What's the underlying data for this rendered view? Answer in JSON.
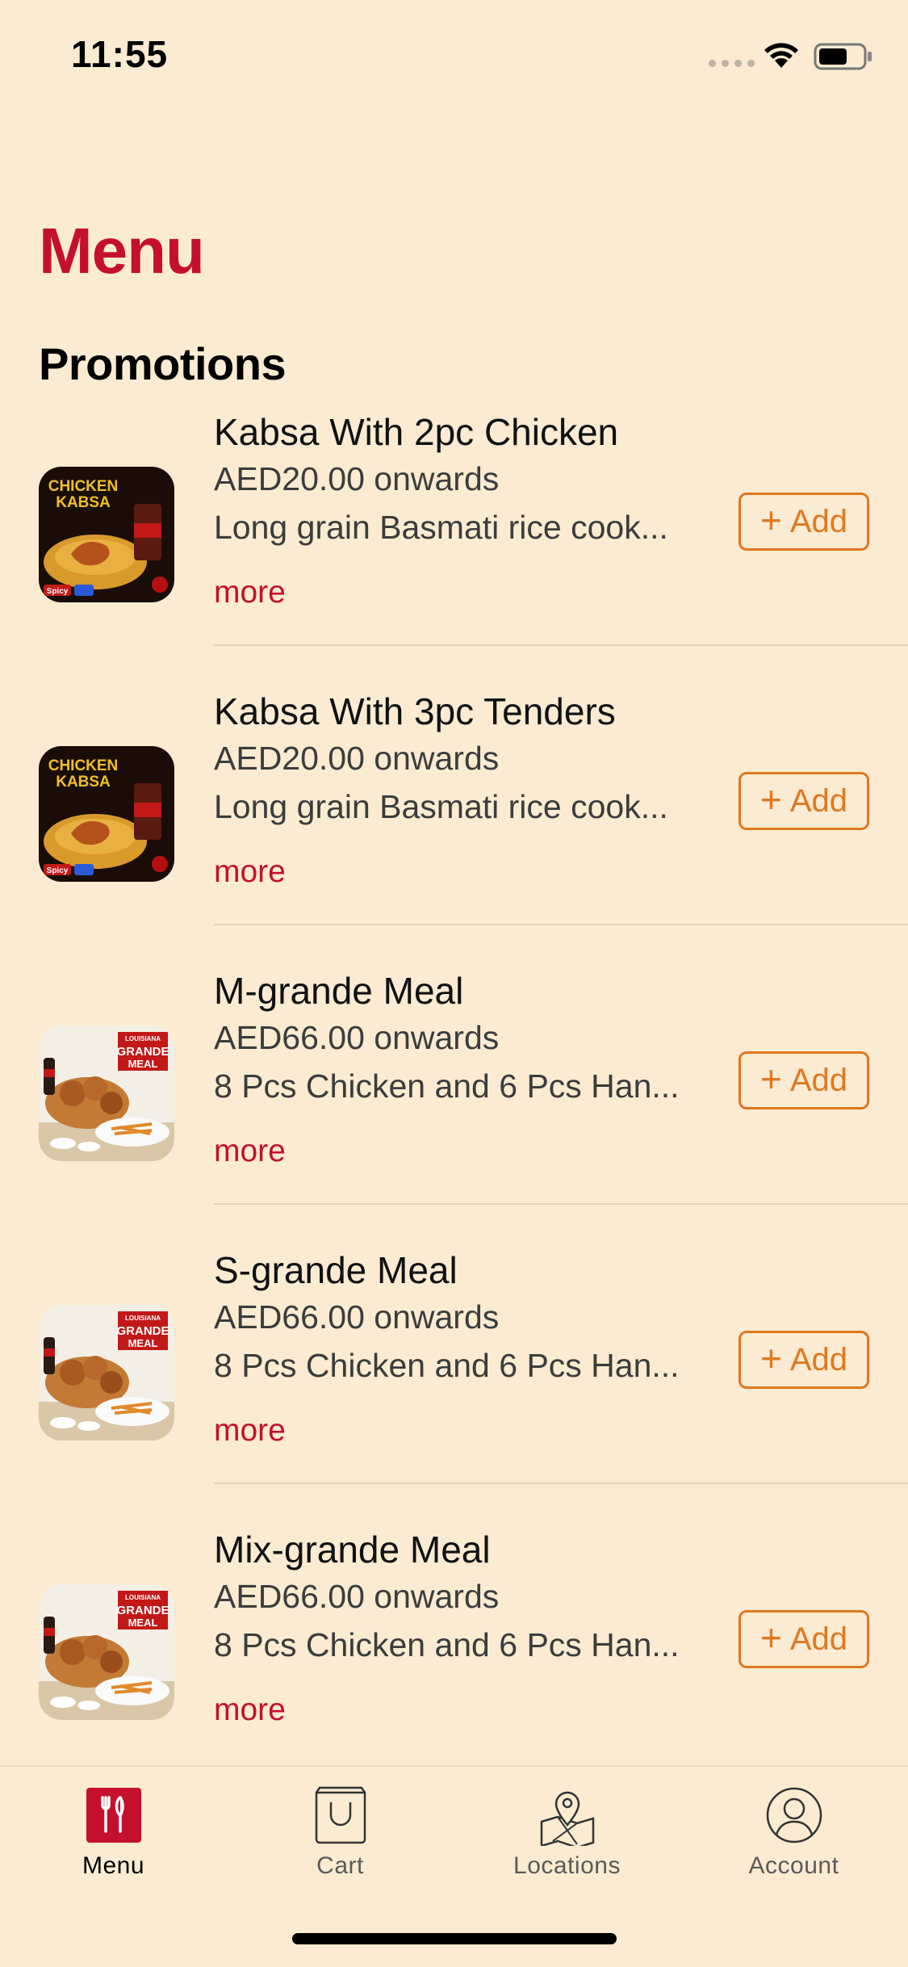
{
  "status_bar": {
    "time": "11:55"
  },
  "page_title": "Menu",
  "section_title": "Promotions",
  "items": [
    {
      "name": "Kabsa With 2pc Chicken",
      "price": "AED20.00 onwards",
      "description": "Long grain Basmati rice cook...",
      "more": "more",
      "add": "Add",
      "thumb": "kabsa"
    },
    {
      "name": "Kabsa With 3pc Tenders",
      "price": "AED20.00 onwards",
      "description": "Long grain Basmati rice cook...",
      "more": "more",
      "add": "Add",
      "thumb": "kabsa"
    },
    {
      "name": "M-grande Meal",
      "price": "AED66.00 onwards",
      "description": "8 Pcs Chicken and 6 Pcs Han...",
      "more": "more",
      "add": "Add",
      "thumb": "grande"
    },
    {
      "name": "S-grande Meal",
      "price": "AED66.00 onwards",
      "description": "8 Pcs Chicken and 6 Pcs Han...",
      "more": "more",
      "add": "Add",
      "thumb": "grande"
    },
    {
      "name": "Mix-grande Meal",
      "price": "AED66.00 onwards",
      "description": "8 Pcs Chicken and 6 Pcs Han...",
      "more": "more",
      "add": "Add",
      "thumb": "grande"
    }
  ],
  "thumb_text": {
    "kabsa": {
      "line1": "CHICKEN",
      "line2": "KABSA",
      "badge": "Spicy"
    },
    "grande": {
      "line0": "LOUISIANA",
      "line1": "GRANDE",
      "line2": "MEAL"
    }
  },
  "tabs": [
    {
      "label": "Menu",
      "icon": "menu-icon",
      "active": true
    },
    {
      "label": "Cart",
      "icon": "bag-icon",
      "active": false
    },
    {
      "label": "Locations",
      "icon": "map-pin-icon",
      "active": false
    },
    {
      "label": "Account",
      "icon": "user-icon",
      "active": false
    }
  ],
  "colors": {
    "background": "#faebd2",
    "brand_red": "#c4102e",
    "accent_orange": "#e07820"
  }
}
